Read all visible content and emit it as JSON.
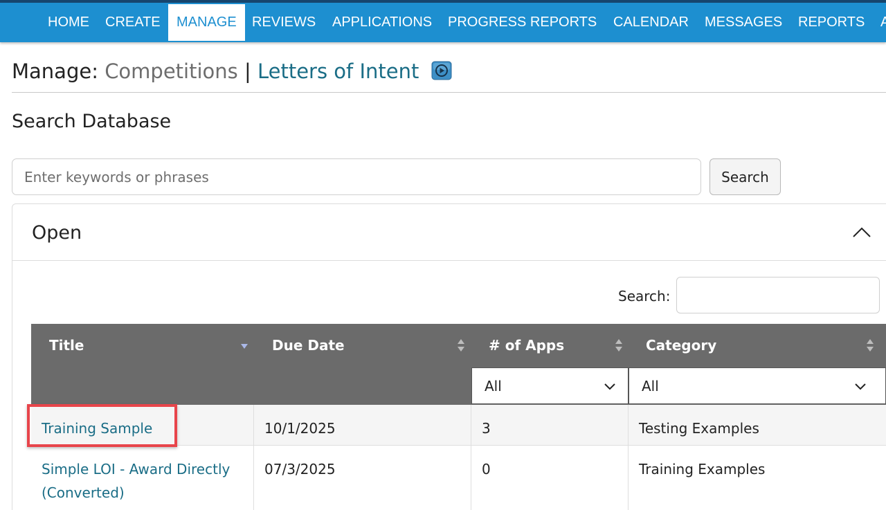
{
  "nav": {
    "items": [
      {
        "label": "HOME"
      },
      {
        "label": "CREATE"
      },
      {
        "label": "MANAGE"
      },
      {
        "label": "REVIEWS"
      },
      {
        "label": "APPLICATIONS"
      },
      {
        "label": "PROGRESS REPORTS"
      },
      {
        "label": "CALENDAR"
      },
      {
        "label": "MESSAGES"
      },
      {
        "label": "REPORTS"
      },
      {
        "label": "A"
      }
    ],
    "active": "MANAGE"
  },
  "heading": {
    "label": "Manage:",
    "current": "Competitions",
    "separator": "|",
    "link": "Letters of Intent",
    "icon": "play-video-icon"
  },
  "search": {
    "title": "Search Database",
    "placeholder": "Enter keywords or phrases",
    "button_label": "Search"
  },
  "panel": {
    "title": "Open",
    "collapse_icon": "chevron-up-icon",
    "filter_label": "Search:"
  },
  "table": {
    "columns": [
      {
        "label": "Title",
        "sort": "sorted-desc"
      },
      {
        "label": "Due Date",
        "sort": "sortable"
      },
      {
        "label": "# of Apps",
        "sort": "sortable"
      },
      {
        "label": "Category",
        "sort": "sortable"
      }
    ],
    "filters": {
      "apps": "All",
      "category": "All"
    },
    "rows": [
      {
        "title": "Training Sample",
        "due_date": "10/1/2025",
        "apps": "3",
        "category": "Testing Examples"
      },
      {
        "title_line1": "Simple LOI - Award Directly",
        "title_line2": "(Converted)",
        "due_date": "07/3/2025",
        "apps": "0",
        "category": "Training Examples"
      }
    ]
  },
  "colors": {
    "nav_bg": "#1d8fd0",
    "nav_border": "#16456d",
    "link": "#1a6d86",
    "table_header": "#6b6b6b",
    "highlight": "#e8454b"
  }
}
